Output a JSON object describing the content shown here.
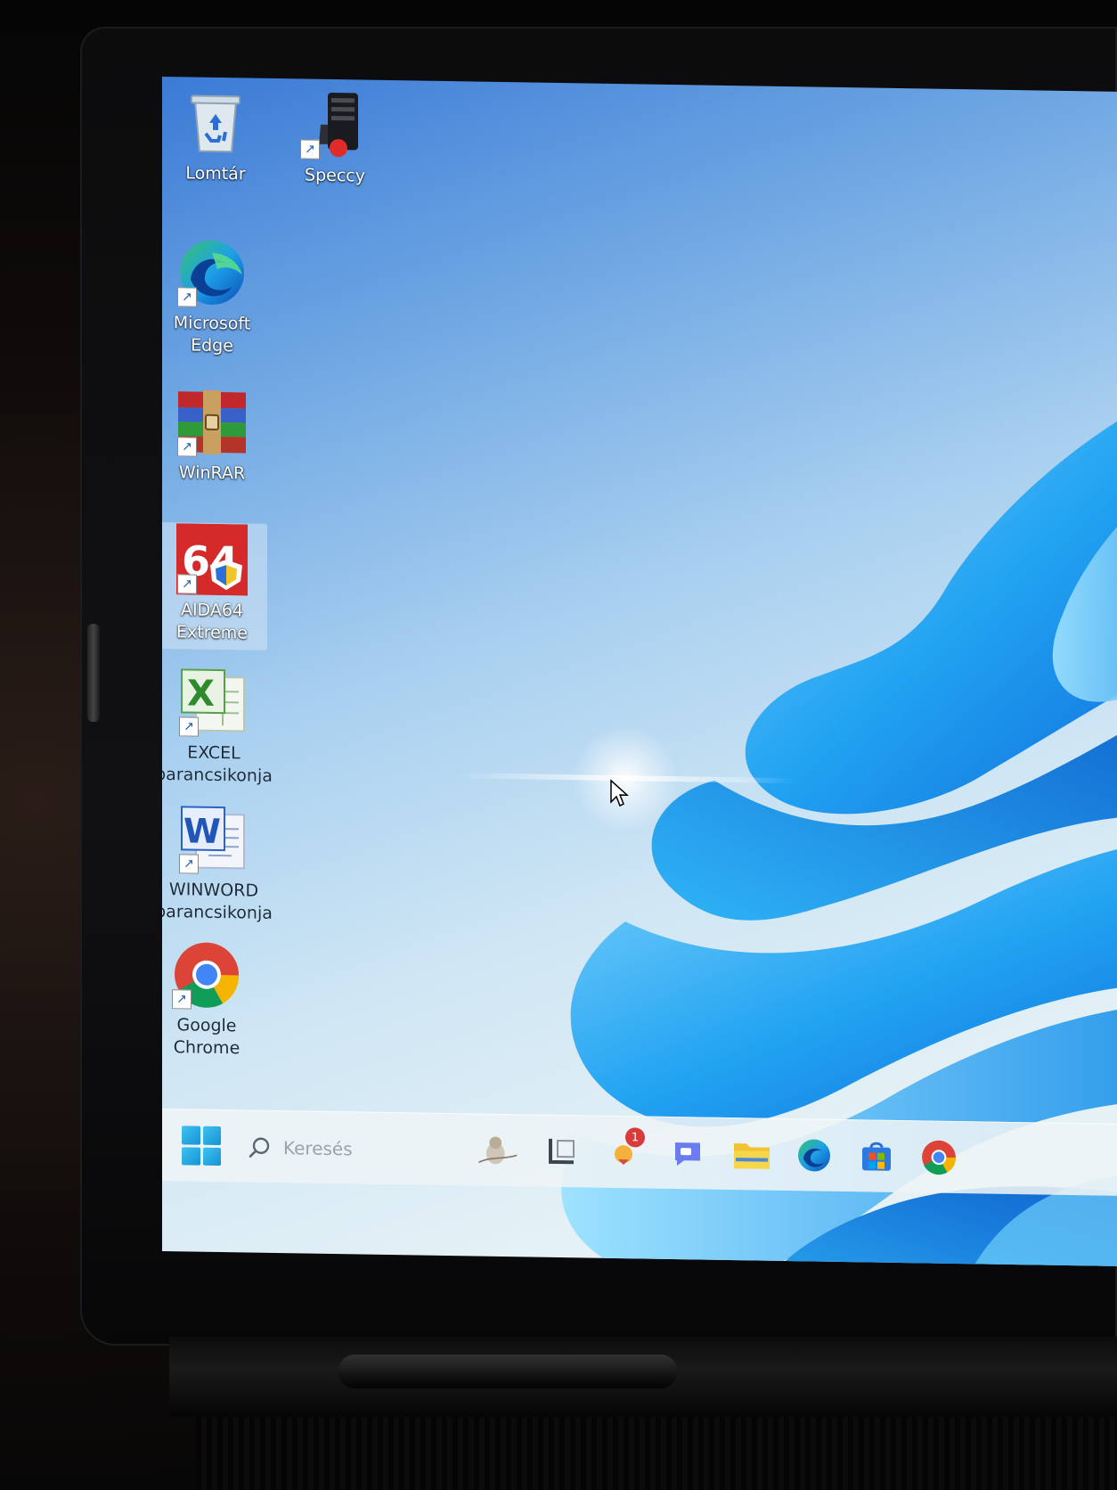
{
  "desktop": {
    "icons": [
      {
        "label": "Lomtár",
        "icon": "recycle-bin-icon"
      },
      {
        "label": "Speccy",
        "icon": "speccy-icon"
      },
      {
        "label": "Microsoft\nEdge",
        "icon": "edge-icon"
      },
      {
        "label": "WinRAR",
        "icon": "winrar-icon"
      },
      {
        "label": "AIDA64\nExtreme",
        "icon": "aida64-icon"
      },
      {
        "label": "EXCEL\nparancsikonja",
        "icon": "excel-icon"
      },
      {
        "label": "WINWORD\nparancsikonja",
        "icon": "word-icon"
      },
      {
        "label": "Google\nChrome",
        "icon": "chrome-icon"
      }
    ],
    "selected_icon": "AIDA64 Extreme"
  },
  "taskbar": {
    "search_placeholder": "Keresés",
    "pinned": [
      {
        "name": "widgets",
        "icon": "widgets-icon"
      },
      {
        "name": "task-view",
        "icon": "task-view-icon"
      },
      {
        "name": "notifications",
        "icon": "notifications-icon",
        "badge": "1"
      },
      {
        "name": "chat",
        "icon": "chat-icon"
      },
      {
        "name": "file-explorer",
        "icon": "folder-icon"
      },
      {
        "name": "microsoft-edge",
        "icon": "edge-icon"
      },
      {
        "name": "microsoft-store",
        "icon": "store-icon"
      },
      {
        "name": "google-chrome",
        "icon": "chrome-icon"
      }
    ]
  },
  "colors": {
    "accent": "#1592d6",
    "wallpaper_top": "#3b7ad6",
    "wallpaper_bottom": "#e9f2f2",
    "bloom": "#22a3f2",
    "badge": "#d83b3b"
  }
}
